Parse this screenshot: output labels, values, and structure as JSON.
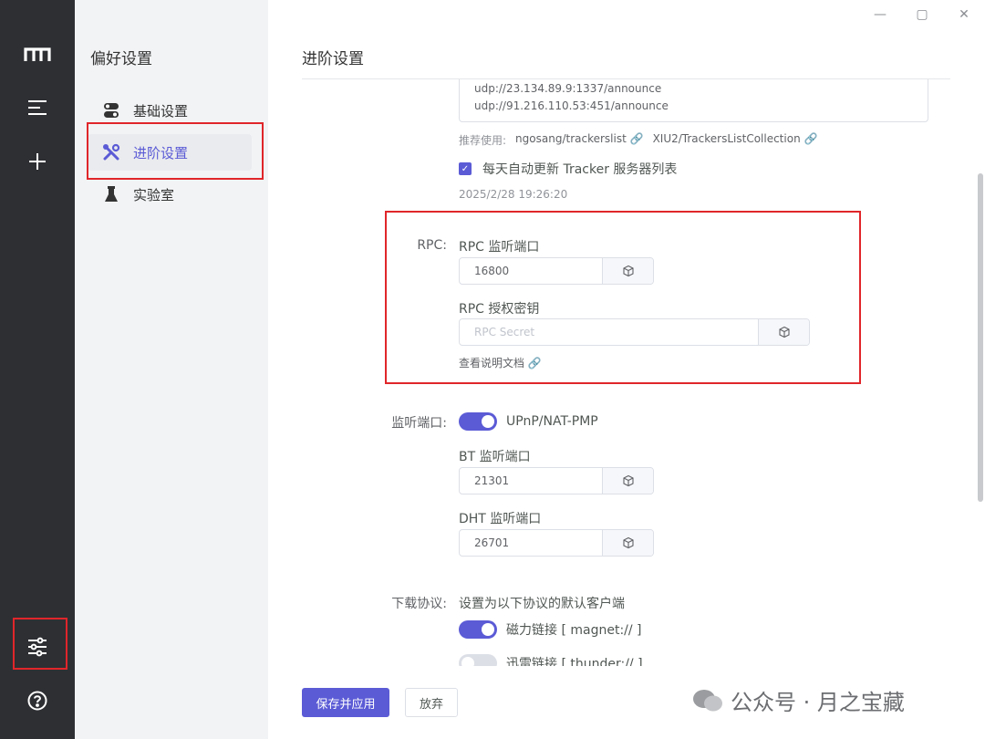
{
  "prefs": {
    "title": "偏好设置",
    "items": [
      {
        "label": "基础设置",
        "icon": "toggle-icon"
      },
      {
        "label": "进阶设置",
        "icon": "tools-icon"
      },
      {
        "label": "实验室",
        "icon": "flask-icon"
      }
    ]
  },
  "main": {
    "title": "进阶设置",
    "trackers": [
      "udp://23.134.89.9:1337/announce",
      "udp://91.216.110.53:451/announce"
    ],
    "recommend_label": "推荐使用:",
    "recommend_links": [
      "ngosang/trackerslist",
      "XIU2/TrackersListCollection"
    ],
    "auto_update_label": "每天自动更新 Tracker 服务器列表",
    "auto_update_checked": true,
    "last_update": "2025/2/28 19:26:20",
    "rpc": {
      "label": "RPC:",
      "port_title": "RPC 监听端口",
      "port_value": "16800",
      "secret_title": "RPC 授权密钥",
      "secret_placeholder": "RPC Secret",
      "doc_link": "查看说明文档"
    },
    "listen": {
      "label": "监听端口:",
      "upnp_label": "UPnP/NAT-PMP",
      "upnp_on": true,
      "bt_title": "BT 监听端口",
      "bt_value": "21301",
      "dht_title": "DHT 监听端口",
      "dht_value": "26701"
    },
    "protocol": {
      "label": "下载协议:",
      "desc": "设置为以下协议的默认客户端",
      "magnet_label": "磁力链接 [ magnet:// ]",
      "magnet_on": true,
      "thunder_label": "迅雷链接 [ thunder:// ]",
      "thunder_on": false
    },
    "save_button": "保存并应用",
    "discard_button": "放弃"
  },
  "watermark": "公众号 · 月之宝藏",
  "colors": {
    "accent": "#5b5bd6",
    "highlight": "#e0262a",
    "rail": "#2e2f33"
  }
}
